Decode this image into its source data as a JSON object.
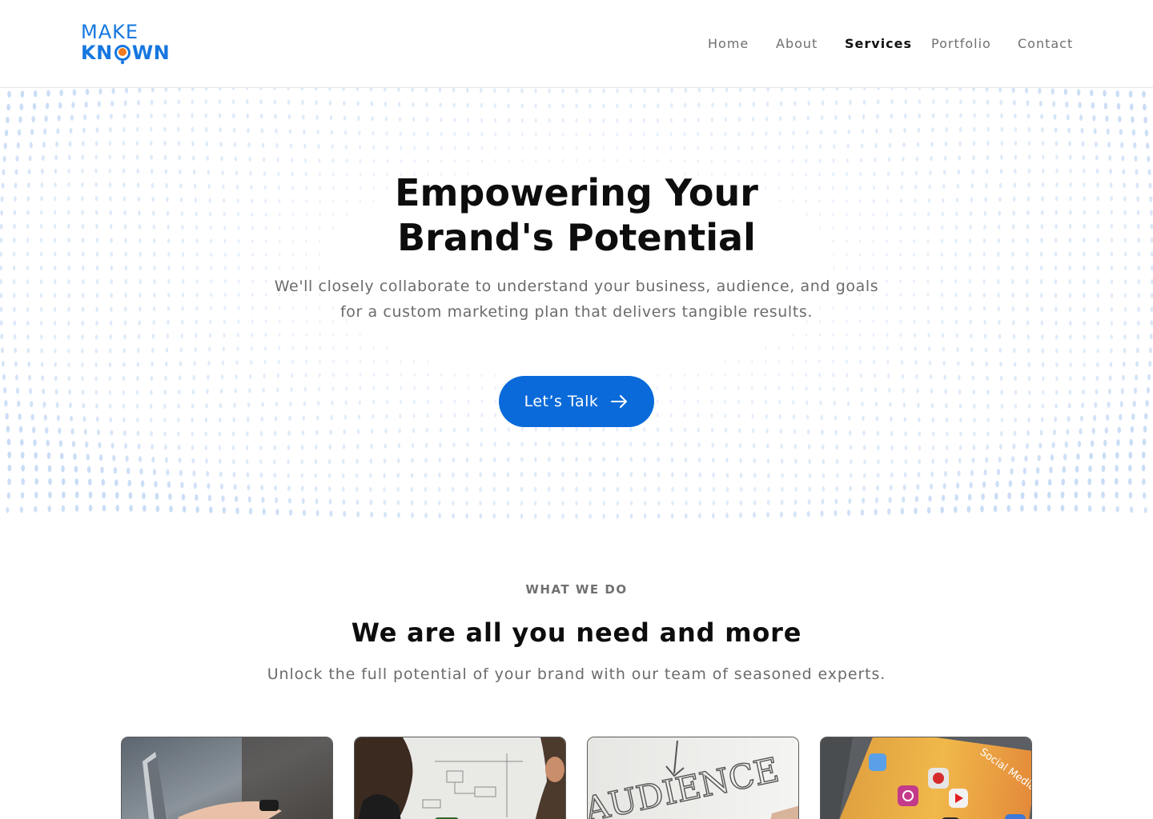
{
  "brand": {
    "line1": "MAKE",
    "line2_a": "KN",
    "line2_b": "WN",
    "primary_color": "#1677e0",
    "accent_color": "#f07a1e"
  },
  "nav": {
    "items": [
      {
        "label": "Home",
        "active": false
      },
      {
        "label": "About",
        "active": false
      },
      {
        "label": "Services",
        "active": true
      },
      {
        "label": "Portfolio",
        "active": false
      },
      {
        "label": "Contact",
        "active": false
      }
    ]
  },
  "hero": {
    "title_line1": "Empowering Your",
    "title_line2": "Brand's Potential",
    "subtitle_line1": "We'll closely collaborate to understand your business, audience, and goals",
    "subtitle_line2": "for a custom marketing plan that delivers tangible results.",
    "cta_label": "Let’s Talk",
    "cta_icon": "arrow-right-icon",
    "cta_color": "#0a6ad9"
  },
  "services": {
    "eyebrow": "WHAT WE DO",
    "title": "We are all you need and more",
    "subtitle": "Unlock the full potential of your brand with our team of seasoned experts.",
    "cards": [
      {
        "image": "laptop-photo"
      },
      {
        "image": "whiteboard-meeting-photo"
      },
      {
        "image": "audience-sketch-photo",
        "image_text": "AUDIENCE"
      },
      {
        "image": "social-media-apps-photo",
        "image_text": "Social Media"
      }
    ]
  }
}
